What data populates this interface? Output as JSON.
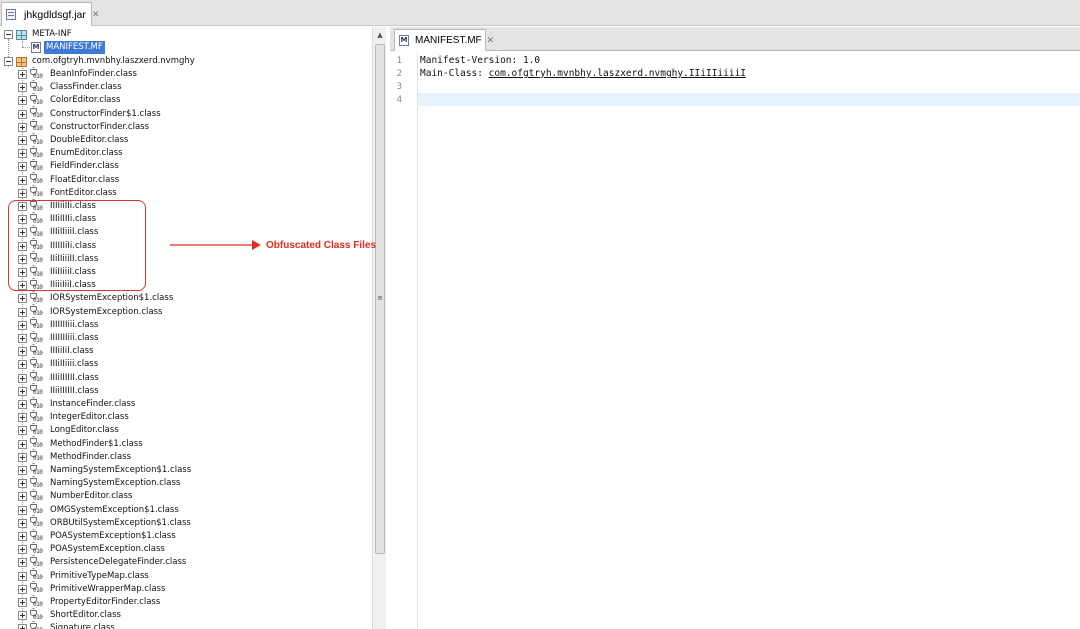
{
  "top_tab": {
    "label": "jhkgdldsgf.jar",
    "icon": "jar-file-icon"
  },
  "tree": {
    "meta_inf": {
      "label": "META-INF"
    },
    "manifest": {
      "label": "MANIFEST.MF"
    },
    "package": {
      "label": "com.ofgtryh.mvnbhy.laszxerd.nvmghy"
    },
    "classes": [
      "BeanInfoFinder.class",
      "ClassFinder.class",
      "ColorEditor.class",
      "ConstructorFinder$1.class",
      "ConstructorFinder.class",
      "DoubleEditor.class",
      "EnumEditor.class",
      "FieldFinder.class",
      "FloatEditor.class",
      "FontEditor.class",
      "IIIIiiIIi.class",
      "IIIiIIIIi.class",
      "IIIiIIiiiI.class",
      "IIIIIIiIi.class",
      "IIiIIiiiII.class",
      "IIiIIiiiI.class",
      "IIiiiIiiI.class",
      "IORSystemException$1.class",
      "IORSystemException.class",
      "IIIIIIIiii.class",
      "IIIIIIIiii.class",
      "IIIiiIiI.class",
      "IIIiIIiiii.class",
      "IIIiIIIIII.class",
      "IIiiIIIIII.class",
      "InstanceFinder.class",
      "IntegerEditor.class",
      "LongEditor.class",
      "MethodFinder$1.class",
      "MethodFinder.class",
      "NamingSystemException$1.class",
      "NamingSystemException.class",
      "NumberEditor.class",
      "OMGSystemException$1.class",
      "ORBUtilSystemException$1.class",
      "POASystemException$1.class",
      "POASystemException.class",
      "PersistenceDelegateFinder.class",
      "PrimitiveTypeMap.class",
      "PrimitiveWrapperMap.class",
      "PropertyEditorFinder.class",
      "ShortEditor.class",
      "Signature.class"
    ]
  },
  "annotation": {
    "text": "Obfuscated Class Files",
    "color": "#e02b20"
  },
  "editor": {
    "tab_label": "MANIFEST.MF",
    "line_numbers": [
      "1",
      "2",
      "3",
      "4"
    ],
    "line1": "Manifest-Version: 1.0",
    "line2_key": "Main-Class: ",
    "line2_value": "com.ofgtryh.mvnbhy.laszxerd.nvmghy.IIiIIiiiiI",
    "line3": "",
    "line4": ""
  },
  "colors": {
    "selection": "#3d7ad6",
    "current_line": "#e8f2fe",
    "annotation": "#d43a2a"
  }
}
